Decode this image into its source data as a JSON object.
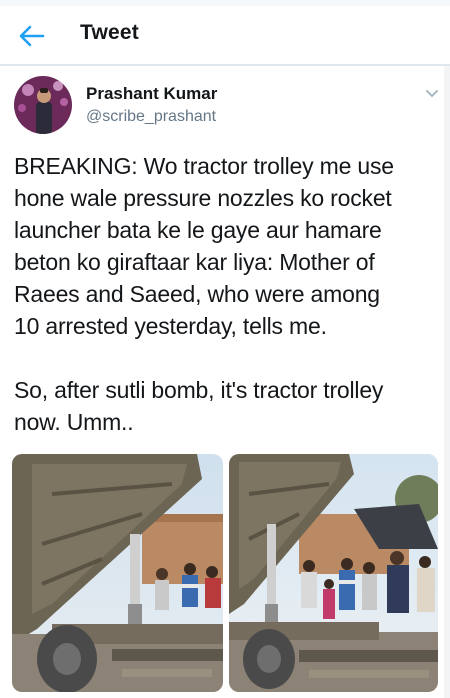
{
  "header": {
    "title": "Tweet"
  },
  "tweet": {
    "author_name": "Prashant Kumar",
    "author_handle": "@scribe_prashant",
    "text_lines": [
      "BREAKING: Wo tractor trolley me use",
      "hone wale pressure nozzles ko rocket",
      "launcher bata ke le gaye aur hamare",
      "beton ko giraftaar kar liya: Mother of",
      "Raees and Saeed, who were among",
      "10 arrested yesterday, tells me.",
      "So, after sutli bomb, it's tractor trolley",
      "now. Umm.."
    ]
  },
  "colors": {
    "accent": "#1da1f2",
    "text": "#14171a",
    "secondary": "#657786",
    "divider": "#e1e8ed"
  },
  "icons": {
    "back": "arrow-left",
    "more": "chevron-down"
  }
}
